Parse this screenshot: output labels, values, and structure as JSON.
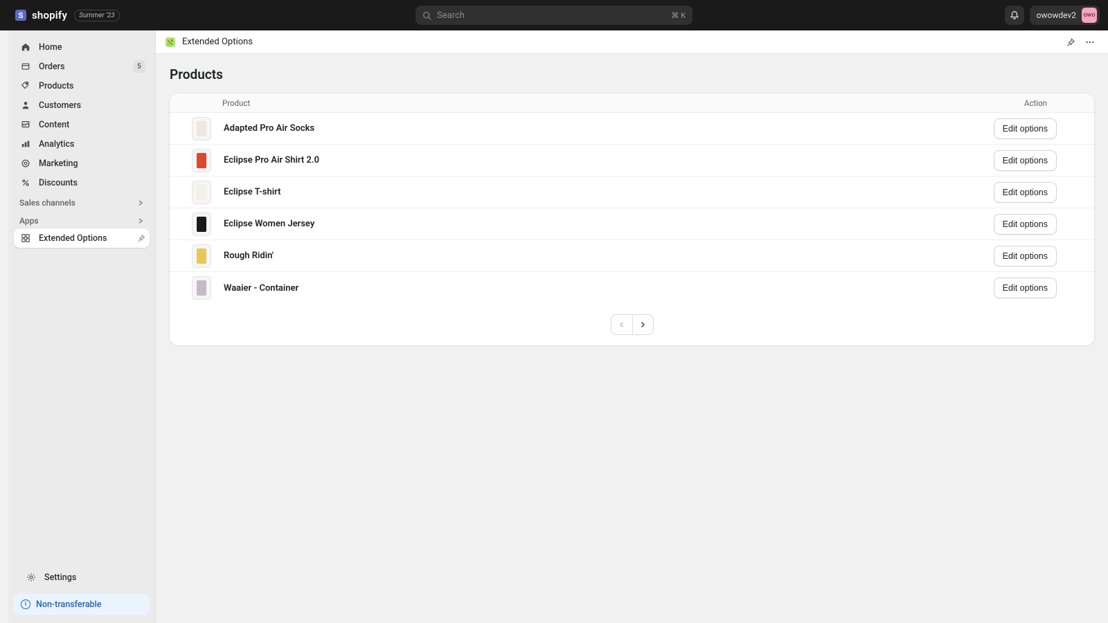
{
  "brand": {
    "logo_letter": "S",
    "logo_text": "shopify",
    "season_tag": "Summer '23"
  },
  "search": {
    "placeholder": "Search",
    "shortcut": "⌘ K"
  },
  "account": {
    "name": "owowdev2",
    "avatar_initials": "owo"
  },
  "sidebar": {
    "items": [
      {
        "label": "Home"
      },
      {
        "label": "Orders",
        "badge": "5"
      },
      {
        "label": "Products"
      },
      {
        "label": "Customers"
      },
      {
        "label": "Content"
      },
      {
        "label": "Analytics"
      },
      {
        "label": "Marketing"
      },
      {
        "label": "Discounts"
      }
    ],
    "sales_channels_label": "Sales channels",
    "apps_label": "Apps",
    "active_app": "Extended Options",
    "settings_label": "Settings",
    "nontransferable_label": "Non-transferable"
  },
  "app_header": {
    "title": "Extended Options"
  },
  "page": {
    "title": "Products"
  },
  "table": {
    "columns": {
      "product": "Product",
      "action": "Action"
    },
    "action_label": "Edit options",
    "rows": [
      {
        "name": "Adapted Pro Air Socks",
        "swatch": "#efe6df"
      },
      {
        "name": "Eclipse Pro Air Shirt 2.0",
        "swatch": "#d94a2a"
      },
      {
        "name": "Eclipse T-shirt",
        "swatch": "#f4efe8"
      },
      {
        "name": "Eclipse Women Jersey",
        "swatch": "#1a1a1a"
      },
      {
        "name": "Rough Ridin'",
        "swatch": "#e8c65a"
      },
      {
        "name": "Waaier - Container",
        "swatch": "#c9b8c6"
      }
    ]
  }
}
